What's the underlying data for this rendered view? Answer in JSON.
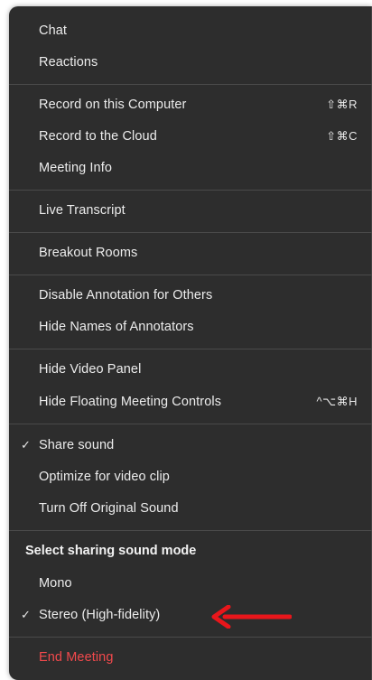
{
  "menu": {
    "chat": "Chat",
    "reactions": "Reactions",
    "record_computer": "Record on this Computer",
    "record_computer_shortcut": "⇧⌘R",
    "record_cloud": "Record to the Cloud",
    "record_cloud_shortcut": "⇧⌘C",
    "meeting_info": "Meeting Info",
    "live_transcript": "Live Transcript",
    "breakout_rooms": "Breakout Rooms",
    "disable_annotation": "Disable Annotation for Others",
    "hide_annotators": "Hide Names of Annotators",
    "hide_video_panel": "Hide Video Panel",
    "hide_floating_controls": "Hide Floating Meeting Controls",
    "hide_floating_controls_shortcut": "^⌥⌘H",
    "share_sound": "Share sound",
    "share_sound_checked": true,
    "optimize_video": "Optimize for video clip",
    "turn_off_original_sound": "Turn Off Original Sound",
    "sound_mode_header": "Select sharing sound mode",
    "mono": "Mono",
    "stereo": "Stereo (High-fidelity)",
    "stereo_checked": true,
    "end_meeting": "End Meeting",
    "check_glyph": "✓"
  },
  "colors": {
    "menu_bg": "#2d2d2d",
    "text": "#ececec",
    "separator": "#4a4a4a",
    "danger": "#f2494c",
    "annotation_arrow": "#e8161b"
  },
  "annotation": {
    "icon": "red-arrow-icon"
  }
}
